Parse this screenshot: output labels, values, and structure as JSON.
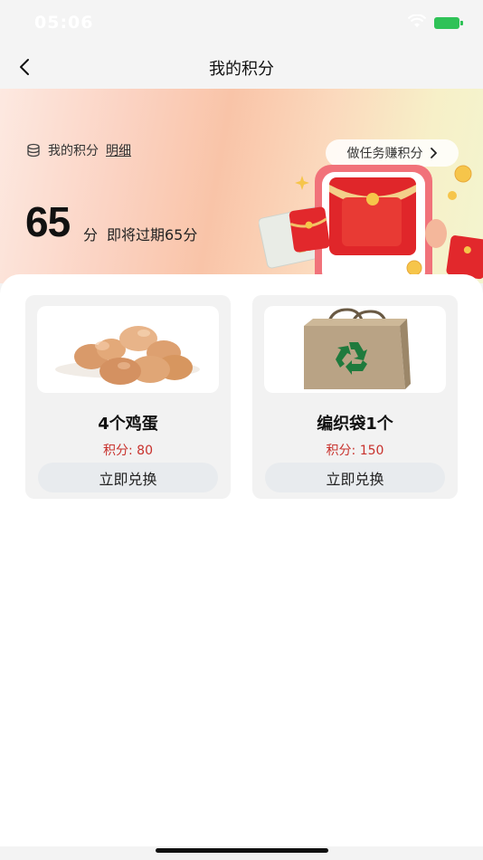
{
  "status_bar": {
    "time": "05:06"
  },
  "nav": {
    "title": "我的积分"
  },
  "banner": {
    "points_label": "我的积分",
    "detail_link": "明细",
    "task_button": "做任务赚积分",
    "points_value": "65",
    "points_unit": "分",
    "expire_text": "即将过期65分"
  },
  "products": [
    {
      "name": "4个鸡蛋",
      "points": "积分: 80",
      "button": "立即兑换",
      "image_icon": "eggs-image"
    },
    {
      "name": "编织袋1个",
      "points": "积分: 150",
      "button": "立即兑换",
      "image_icon": "recycle-bag-image"
    }
  ],
  "colors": {
    "points_red": "#c8312c",
    "battery_green": "#2fc257",
    "redeem_button_bg": "#e8ebee"
  }
}
